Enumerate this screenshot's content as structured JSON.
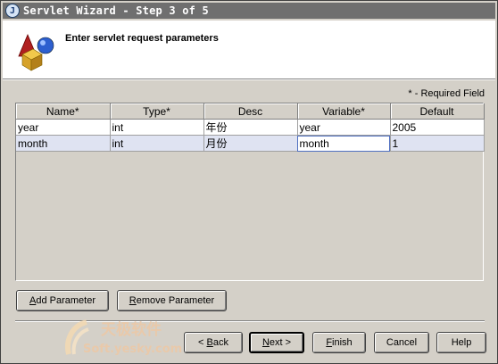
{
  "window": {
    "title": "Servlet Wizard - Step 3 of 5",
    "app_icon_letter": "J"
  },
  "header": {
    "title": "Enter servlet request parameters",
    "icon": "wizard-shapes-icon"
  },
  "required_note": "* - Required Field",
  "table": {
    "columns": [
      "Name*",
      "Type*",
      "Desc",
      "Variable*",
      "Default"
    ],
    "rows": [
      {
        "name": "year",
        "type": "int",
        "desc": "年份",
        "variable": "year",
        "default": "2005"
      },
      {
        "name": "month",
        "type": "int",
        "desc": "月份",
        "variable": "month",
        "default": "1"
      }
    ],
    "selected_row": 1
  },
  "buttons": {
    "add_parameter": {
      "mnemonic": "A",
      "rest": "dd Parameter"
    },
    "remove_parameter": {
      "mnemonic": "R",
      "rest": "emove Parameter"
    },
    "back": {
      "prefix": "< ",
      "mnemonic": "B",
      "rest": "ack"
    },
    "next": {
      "mnemonic": "N",
      "rest": "ext >"
    },
    "finish": {
      "mnemonic": "F",
      "rest": "inish"
    },
    "cancel": "Cancel",
    "help": "Help"
  },
  "watermark": {
    "line1": "天极软件",
    "line2": "Soft.yesky.com"
  },
  "colors": {
    "titlebar": "#6f6f6f",
    "dialog_bg": "#d4d0c8",
    "selected_row": "#dfe3f2"
  }
}
